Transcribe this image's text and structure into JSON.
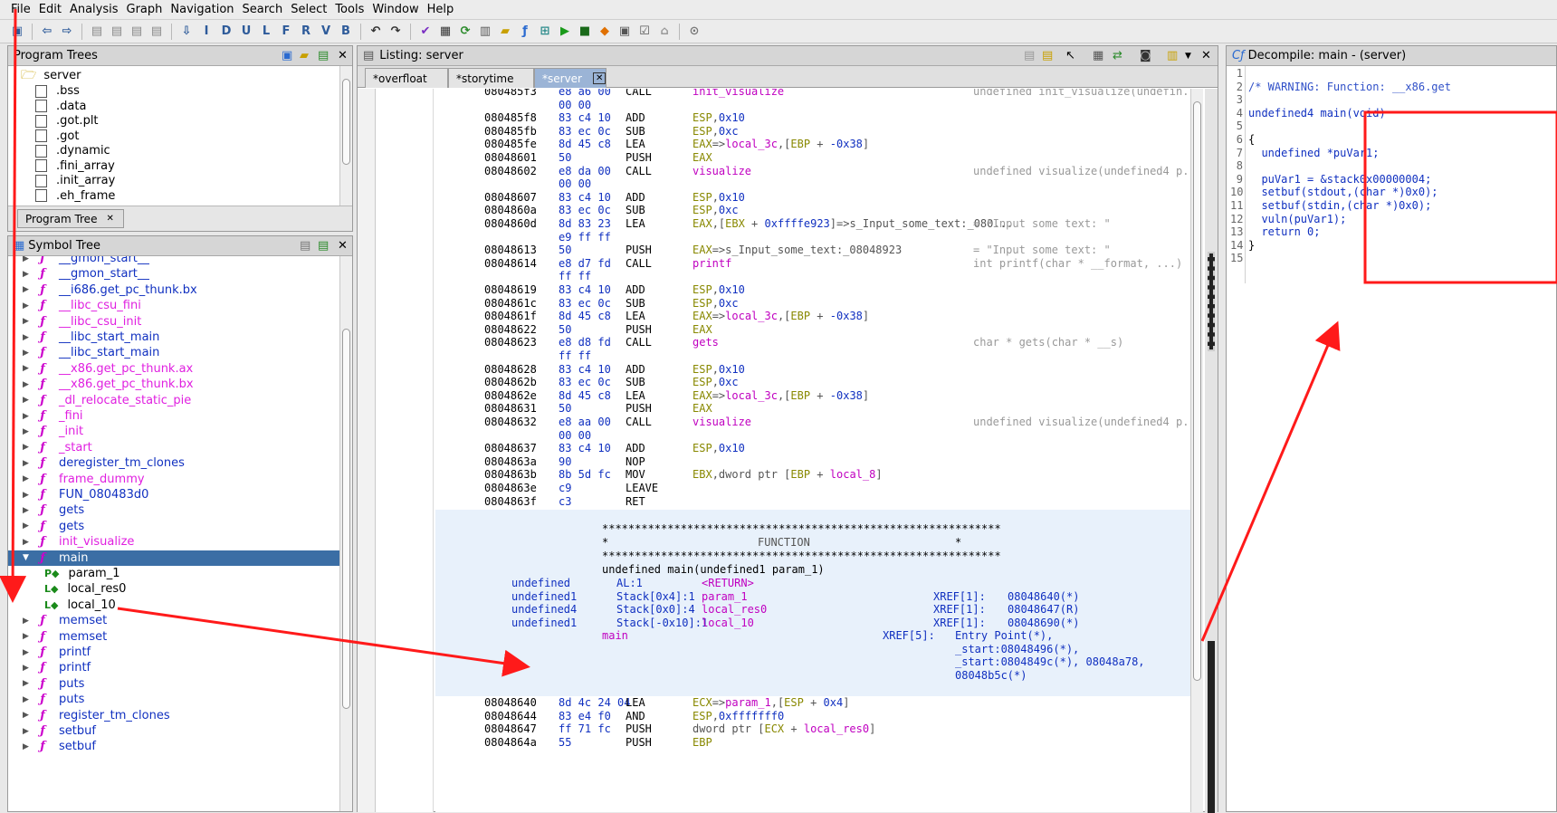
{
  "menu": [
    "File",
    "Edit",
    "Analysis",
    "Graph",
    "Navigation",
    "Search",
    "Select",
    "Tools",
    "Window",
    "Help"
  ],
  "program_trees": {
    "title": "Program Trees",
    "root": "server",
    "items": [
      ".bss",
      ".data",
      ".got.plt",
      ".got",
      ".dynamic",
      ".fini_array",
      ".init_array",
      ".eh_frame"
    ],
    "tab": "Program Tree"
  },
  "symbol_tree": {
    "title": "Symbol Tree",
    "items": [
      {
        "label": "__gmon_start__",
        "color": "blue",
        "ext": true
      },
      {
        "label": "__gmon_start__",
        "color": "blue",
        "ext": true
      },
      {
        "label": "__i686.get_pc_thunk.bx",
        "color": "blue",
        "ext": false
      },
      {
        "label": "__libc_csu_fini",
        "color": "mag",
        "ext": false
      },
      {
        "label": "__libc_csu_init",
        "color": "mag",
        "ext": false
      },
      {
        "label": "__libc_start_main",
        "color": "blue",
        "ext": true
      },
      {
        "label": "__libc_start_main",
        "color": "blue",
        "ext": true
      },
      {
        "label": "__x86.get_pc_thunk.ax",
        "color": "mag",
        "ext": false
      },
      {
        "label": "__x86.get_pc_thunk.bx",
        "color": "mag",
        "ext": false
      },
      {
        "label": "_dl_relocate_static_pie",
        "color": "mag",
        "ext": false
      },
      {
        "label": "_fini",
        "color": "mag",
        "ext": false
      },
      {
        "label": "_init",
        "color": "mag",
        "ext": false
      },
      {
        "label": "_start",
        "color": "mag",
        "ext": false
      },
      {
        "label": "deregister_tm_clones",
        "color": "blue",
        "ext": false
      },
      {
        "label": "frame_dummy",
        "color": "mag",
        "ext": false
      },
      {
        "label": "FUN_080483d0",
        "color": "blue",
        "ext": false
      },
      {
        "label": "gets",
        "color": "blue",
        "ext": true
      },
      {
        "label": "gets",
        "color": "blue",
        "ext": true
      },
      {
        "label": "init_visualize",
        "color": "mag",
        "ext": false
      },
      {
        "label": "main",
        "color": "sel",
        "ext": false
      },
      {
        "label": "param_1",
        "color": "black",
        "child": "P"
      },
      {
        "label": "local_res0",
        "color": "black",
        "child": "L"
      },
      {
        "label": "local_10",
        "color": "black",
        "child": "L"
      },
      {
        "label": "memset",
        "color": "blue",
        "ext": true
      },
      {
        "label": "memset",
        "color": "blue",
        "ext": true
      },
      {
        "label": "printf",
        "color": "blue",
        "ext": true
      },
      {
        "label": "printf",
        "color": "blue",
        "ext": true
      },
      {
        "label": "puts",
        "color": "blue",
        "ext": true
      },
      {
        "label": "puts",
        "color": "blue",
        "ext": true
      },
      {
        "label": "register_tm_clones",
        "color": "blue",
        "ext": false
      },
      {
        "label": "setbuf",
        "color": "blue",
        "ext": true
      },
      {
        "label": "setbuf",
        "color": "blue",
        "ext": true
      }
    ]
  },
  "listing": {
    "title": "Listing:  server",
    "tabs": [
      "*overfloat",
      "*storytime",
      "*server"
    ],
    "rows": [
      {
        "a": "080485f3",
        "b": "e8 a6 00",
        "m": "CALL",
        "o": [
          [
            "lbl",
            "init_visualize"
          ]
        ],
        "c": "undefined init_visualize(undefin..."
      },
      {
        "a": "",
        "b": "00 00",
        "m": "",
        "o": [],
        "c": ""
      },
      {
        "a": "080485f8",
        "b": "83 c4 10",
        "m": "ADD",
        "o": [
          [
            "reg",
            "ESP"
          ],
          [
            "op",
            ","
          ],
          [
            "num",
            "0x10"
          ]
        ],
        "c": ""
      },
      {
        "a": "080485fb",
        "b": "83 ec 0c",
        "m": "SUB",
        "o": [
          [
            "reg",
            "ESP"
          ],
          [
            "op",
            ","
          ],
          [
            "num",
            "0xc"
          ]
        ],
        "c": ""
      },
      {
        "a": "080485fe",
        "b": "8d 45 c8",
        "m": "LEA",
        "o": [
          [
            "reg",
            "EAX"
          ],
          [
            "op",
            "=>"
          ],
          [
            "var",
            "local_3c"
          ],
          [
            "op",
            ",["
          ],
          [
            "reg",
            "EBP"
          ],
          [
            "op",
            " + "
          ],
          [
            "num",
            "-0x38"
          ],
          [
            "op",
            "]"
          ]
        ],
        "c": ""
      },
      {
        "a": "08048601",
        "b": "50",
        "m": "PUSH",
        "o": [
          [
            "reg",
            "EAX"
          ]
        ],
        "c": ""
      },
      {
        "a": "08048602",
        "b": "e8 da 00",
        "m": "CALL",
        "o": [
          [
            "lbl",
            "visualize"
          ]
        ],
        "c": "undefined visualize(undefined4 p..."
      },
      {
        "a": "",
        "b": "00 00",
        "m": "",
        "o": [],
        "c": ""
      },
      {
        "a": "08048607",
        "b": "83 c4 10",
        "m": "ADD",
        "o": [
          [
            "reg",
            "ESP"
          ],
          [
            "op",
            ","
          ],
          [
            "num",
            "0x10"
          ]
        ],
        "c": ""
      },
      {
        "a": "0804860a",
        "b": "83 ec 0c",
        "m": "SUB",
        "o": [
          [
            "reg",
            "ESP"
          ],
          [
            "op",
            ","
          ],
          [
            "num",
            "0xc"
          ]
        ],
        "c": ""
      },
      {
        "a": "0804860d",
        "b": "8d 83 23",
        "m": "LEA",
        "o": [
          [
            "reg",
            "EAX"
          ],
          [
            "op",
            ",["
          ],
          [
            "reg",
            "EBX"
          ],
          [
            "op",
            " + "
          ],
          [
            "num",
            "0xffffe923"
          ],
          [
            "op",
            "]=>s_Input_some_text:_080..."
          ]
        ],
        "c": "= \"Input some text: \""
      },
      {
        "a": "",
        "b": "e9 ff ff",
        "m": "",
        "o": [],
        "c": ""
      },
      {
        "a": "08048613",
        "b": "50",
        "m": "PUSH",
        "o": [
          [
            "reg",
            "EAX"
          ],
          [
            "op",
            "=>s_Input_some_text:_08048923"
          ]
        ],
        "c": "= \"Input some text: \""
      },
      {
        "a": "08048614",
        "b": "e8 d7 fd",
        "m": "CALL",
        "o": [
          [
            "lbl",
            "printf"
          ]
        ],
        "c": "int printf(char * __format, ...)"
      },
      {
        "a": "",
        "b": "ff ff",
        "m": "",
        "o": [],
        "c": ""
      },
      {
        "a": "08048619",
        "b": "83 c4 10",
        "m": "ADD",
        "o": [
          [
            "reg",
            "ESP"
          ],
          [
            "op",
            ","
          ],
          [
            "num",
            "0x10"
          ]
        ],
        "c": ""
      },
      {
        "a": "0804861c",
        "b": "83 ec 0c",
        "m": "SUB",
        "o": [
          [
            "reg",
            "ESP"
          ],
          [
            "op",
            ","
          ],
          [
            "num",
            "0xc"
          ]
        ],
        "c": ""
      },
      {
        "a": "0804861f",
        "b": "8d 45 c8",
        "m": "LEA",
        "o": [
          [
            "reg",
            "EAX"
          ],
          [
            "op",
            "=>"
          ],
          [
            "var",
            "local_3c"
          ],
          [
            "op",
            ",["
          ],
          [
            "reg",
            "EBP"
          ],
          [
            "op",
            " + "
          ],
          [
            "num",
            "-0x38"
          ],
          [
            "op",
            "]"
          ]
        ],
        "c": ""
      },
      {
        "a": "08048622",
        "b": "50",
        "m": "PUSH",
        "o": [
          [
            "reg",
            "EAX"
          ]
        ],
        "c": ""
      },
      {
        "a": "08048623",
        "b": "e8 d8 fd",
        "m": "CALL",
        "o": [
          [
            "lbl",
            "gets"
          ]
        ],
        "c": "char * gets(char * __s)"
      },
      {
        "a": "",
        "b": "ff ff",
        "m": "",
        "o": [],
        "c": ""
      },
      {
        "a": "08048628",
        "b": "83 c4 10",
        "m": "ADD",
        "o": [
          [
            "reg",
            "ESP"
          ],
          [
            "op",
            ","
          ],
          [
            "num",
            "0x10"
          ]
        ],
        "c": ""
      },
      {
        "a": "0804862b",
        "b": "83 ec 0c",
        "m": "SUB",
        "o": [
          [
            "reg",
            "ESP"
          ],
          [
            "op",
            ","
          ],
          [
            "num",
            "0xc"
          ]
        ],
        "c": ""
      },
      {
        "a": "0804862e",
        "b": "8d 45 c8",
        "m": "LEA",
        "o": [
          [
            "reg",
            "EAX"
          ],
          [
            "op",
            "=>"
          ],
          [
            "var",
            "local_3c"
          ],
          [
            "op",
            ",["
          ],
          [
            "reg",
            "EBP"
          ],
          [
            "op",
            " + "
          ],
          [
            "num",
            "-0x38"
          ],
          [
            "op",
            "]"
          ]
        ],
        "c": ""
      },
      {
        "a": "08048631",
        "b": "50",
        "m": "PUSH",
        "o": [
          [
            "reg",
            "EAX"
          ]
        ],
        "c": ""
      },
      {
        "a": "08048632",
        "b": "e8 aa 00",
        "m": "CALL",
        "o": [
          [
            "lbl",
            "visualize"
          ]
        ],
        "c": "undefined visualize(undefined4 p..."
      },
      {
        "a": "",
        "b": "00 00",
        "m": "",
        "o": [],
        "c": ""
      },
      {
        "a": "08048637",
        "b": "83 c4 10",
        "m": "ADD",
        "o": [
          [
            "reg",
            "ESP"
          ],
          [
            "op",
            ","
          ],
          [
            "num",
            "0x10"
          ]
        ],
        "c": ""
      },
      {
        "a": "0804863a",
        "b": "90",
        "m": "NOP",
        "o": [],
        "c": ""
      },
      {
        "a": "0804863b",
        "b": "8b 5d fc",
        "m": "MOV",
        "o": [
          [
            "reg",
            "EBX"
          ],
          [
            "op",
            ",dword ptr ["
          ],
          [
            "reg",
            "EBP"
          ],
          [
            "op",
            " + "
          ],
          [
            "var",
            "local_8"
          ],
          [
            "op",
            "]"
          ]
        ],
        "c": ""
      },
      {
        "a": "0804863e",
        "b": "c9",
        "m": "LEAVE",
        "o": [],
        "c": ""
      },
      {
        "a": "0804863f",
        "b": "c3",
        "m": "RET",
        "o": [],
        "c": ""
      }
    ],
    "func_header": {
      "stars": "*************************************************************",
      "star_mid_left": "*",
      "func_word": "FUNCTION",
      "star_mid_right": "*",
      "signature": "undefined main(undefined1 param_1)",
      "vars": [
        {
          "t": "undefined",
          "s": "AL:1",
          "n": "<RETURN>",
          "x": "",
          "xa": ""
        },
        {
          "t": "undefined1",
          "s": "Stack[0x4]:1",
          "n": "param_1",
          "x": "XREF[1]:",
          "xa": "08048640(*)"
        },
        {
          "t": "undefined4",
          "s": "Stack[0x0]:4",
          "n": "local_res0",
          "x": "XREF[1]:",
          "xa": "08048647(R)"
        },
        {
          "t": "undefined1",
          "s": "Stack[-0x10]:1",
          "n": "local_10",
          "x": "XREF[1]:",
          "xa": "08048690(*)"
        }
      ],
      "label": "main",
      "xref5": "XREF[5]:",
      "xref5_lines": [
        "Entry Point(*),",
        "_start:08048496(*),",
        "_start:0804849c(*), 08048a78,",
        "08048b5c(*)"
      ]
    },
    "rows2": [
      {
        "a": "08048640",
        "b": "8d 4c 24 04",
        "m": "LEA",
        "o": [
          [
            "reg",
            "ECX"
          ],
          [
            "op",
            "=>"
          ],
          [
            "var",
            "param_1"
          ],
          [
            "op",
            ",["
          ],
          [
            "reg",
            "ESP"
          ],
          [
            "op",
            " + "
          ],
          [
            "num",
            "0x4"
          ],
          [
            "op",
            "]"
          ]
        ],
        "c": ""
      },
      {
        "a": "08048644",
        "b": "83 e4 f0",
        "m": "AND",
        "o": [
          [
            "reg",
            "ESP"
          ],
          [
            "op",
            ","
          ],
          [
            "num",
            "0xfffffff0"
          ]
        ],
        "c": ""
      },
      {
        "a": "08048647",
        "b": "ff 71 fc",
        "m": "PUSH",
        "o": [
          [
            "op",
            "dword ptr ["
          ],
          [
            "reg",
            "ECX"
          ],
          [
            "op",
            " + "
          ],
          [
            "var",
            "local_res0"
          ],
          [
            "op",
            "]"
          ]
        ],
        "c": ""
      },
      {
        "a": "0804864a",
        "b": "55",
        "m": "PUSH",
        "o": [
          [
            "reg",
            "EBP"
          ]
        ],
        "c": ""
      }
    ]
  },
  "decompile": {
    "title": "Decompile: main - (server)",
    "lines": [
      {
        "n": "1",
        "t": ""
      },
      {
        "n": "2",
        "t": "/* WARNING: Function: __x86.get"
      },
      {
        "n": "3",
        "t": ""
      },
      {
        "n": "4",
        "t": "undefined4 main(void)"
      },
      {
        "n": "5",
        "t": ""
      },
      {
        "n": "6",
        "t": "{"
      },
      {
        "n": "7",
        "t": "  undefined *puVar1;"
      },
      {
        "n": "8",
        "t": ""
      },
      {
        "n": "9",
        "t": "  puVar1 = &stack0x00000004;"
      },
      {
        "n": "10",
        "t": "  setbuf(stdout,(char *)0x0);"
      },
      {
        "n": "11",
        "t": "  setbuf(stdin,(char *)0x0);"
      },
      {
        "n": "12",
        "t": "  vuln(puVar1);"
      },
      {
        "n": "13",
        "t": "  return 0;"
      },
      {
        "n": "14",
        "t": "}"
      },
      {
        "n": "15",
        "t": ""
      }
    ]
  },
  "colors": {
    "highlight": "#e8f1fb",
    "annotation": "#ff0000",
    "selection": "#3b6ea5"
  }
}
